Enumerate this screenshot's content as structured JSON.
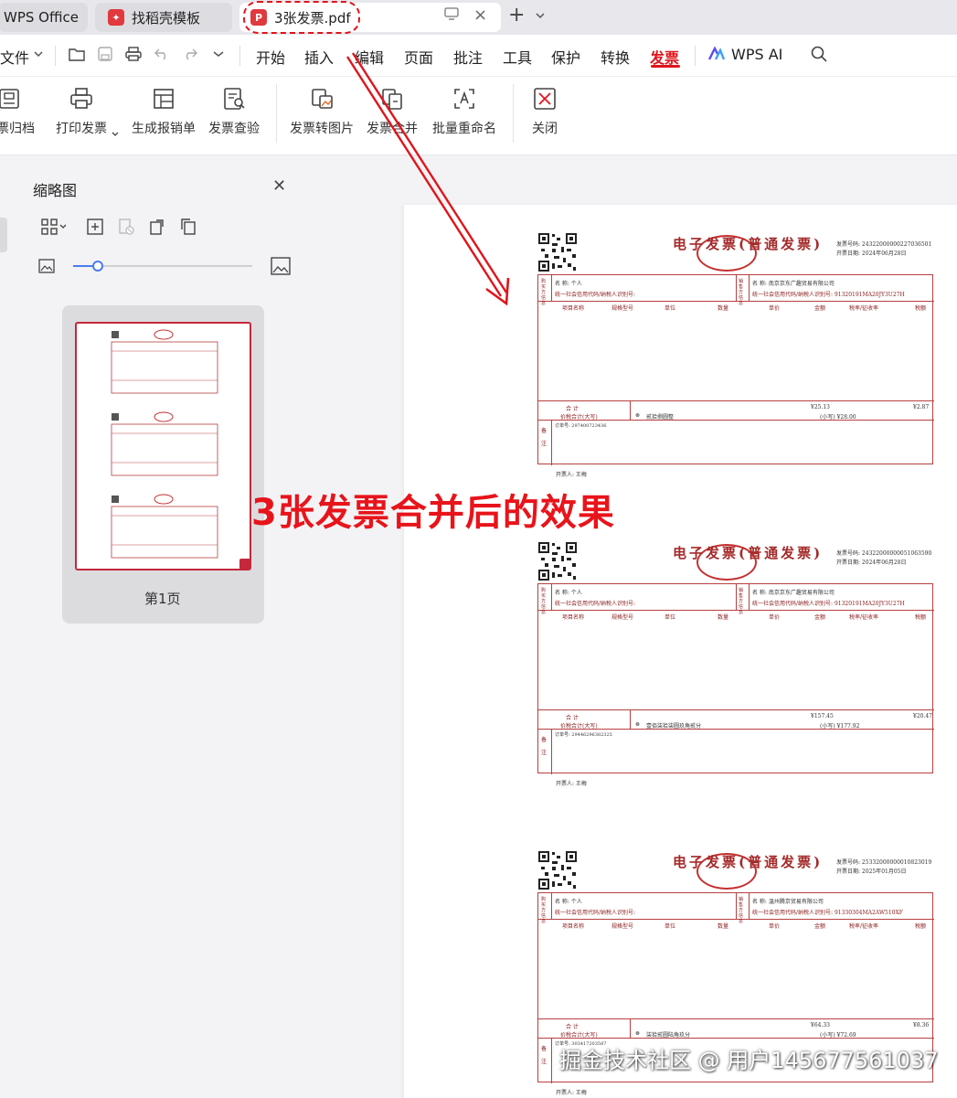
{
  "tabs": {
    "wps_label": "WPS Office",
    "template_label": "找稻壳模板",
    "pdf_label": "3张发票.pdf"
  },
  "menu": [
    "文件",
    "开始",
    "插入",
    "编辑",
    "页面",
    "批注",
    "工具",
    "保护",
    "转换",
    "发票",
    "WPS AI"
  ],
  "ribbon": [
    "发票归档",
    "打印发票",
    "生成报销单",
    "发票查验",
    "发票转图片",
    "发票合并",
    "批量重命名",
    "关闭"
  ],
  "sidebar": {
    "title": "缩略图",
    "page_label": "第1页"
  },
  "caption": "3张发票合并后的效果",
  "watermark": "掘金技术社区 @ 用户145677561037",
  "invoice_common": {
    "title": "电子发票(普通发票)",
    "buyer_name": "名 称: 个人",
    "tax_id_label": "统一社会信用代码/纳税人识别号:",
    "seller_side": "销售方信息",
    "buyer_side": "购买方信息",
    "col_item": "项目名称",
    "col_spec": "规格型号",
    "col_unit": "单位",
    "col_qty": "数量",
    "col_price": "单价",
    "col_amount": "金额",
    "col_rate": "税率/征收率",
    "col_tax": "税额",
    "total_label": "合    计",
    "total_cn_label": "价税合计(大写)",
    "remark": "备注",
    "issuer": "开票人: 王梅"
  },
  "invoices": [
    {
      "no": "发票号码: 24322000000227036501",
      "date": "开票日期: 2024年06月28日",
      "seller": "名 称: 南京京东广趣贸易有限公司",
      "seller_tax": "统一社会信用代码/纳税人识别号: 91320191MA20JY3U27H",
      "sum_amount": "¥25.13",
      "sum_tax": "¥2.87",
      "cn_total": "贰拾捌圆整",
      "small_total": "(小写) ¥28.00",
      "order": "订单号: 297400723436"
    },
    {
      "no": "发票号码: 24322000000051063590",
      "date": "开票日期: 2024年06月28日",
      "seller": "名 称: 南京京东广趣贸易有限公司",
      "seller_tax": "统一社会信用代码/纳税人识别号: 91320191MA20JY3U27H",
      "sum_amount": "¥157.45",
      "sum_tax": "¥20.47",
      "cn_total": "壹佰柒拾柒圆玖角贰分",
      "small_total": "(小写) ¥177.92",
      "order": "订单号: 29446296382325"
    },
    {
      "no": "发票号码: 25332000000010823019",
      "date": "开票日期: 2025年01月05日",
      "seller": "名 称: 温州腾京贸易有限公司",
      "seller_tax": "统一社会信用代码/纳税人识别号: 91330304MA2AW510XF",
      "sum_amount": "¥64.33",
      "sum_tax": "¥8.36",
      "cn_total": "柒拾贰圆陆角玖分",
      "small_total": "(小写) ¥72.69",
      "order": "订单号: 303417203587"
    }
  ]
}
